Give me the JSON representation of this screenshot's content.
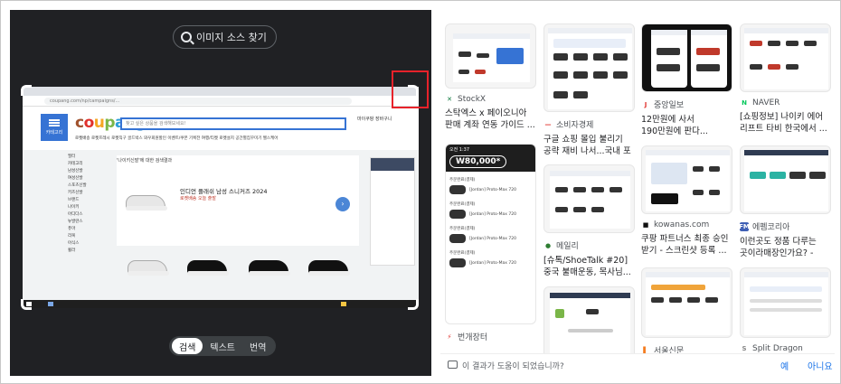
{
  "left_panel": {
    "find_source_label": "이미지 소스 찾기",
    "modes": [
      "검색",
      "텍스트",
      "번역"
    ],
    "screenshot": {
      "url": "coupang.com/np/campaigns/...",
      "logo": [
        "c",
        "o",
        "u",
        "p",
        "a",
        "n",
        "g"
      ],
      "menu_label": "카테고리",
      "search_placeholder": "찾고 싶은 상품을 검색해보세요!",
      "categories": "로켓배송  로켓프레시  로켓직구  골드박스  와우회원할인  이벤트/쿠폰  기획전  여행/티켓  로켓설치  공간별집꾸미기  헬스케어",
      "header_icons": "마이쿠팡   장바구니",
      "sidebar": [
        "필터",
        "카테고리",
        "남성신발",
        "여성신발",
        "스포츠신발",
        "키즈신발",
        "브랜드",
        "나이키",
        "아디다스",
        "뉴발란스",
        "퓨마",
        "리복",
        "아식스",
        "휠라"
      ],
      "banner_top": "'나이키신발'에 대한 검색결과",
      "banner_title": "인디언 플래쉬 남성 스니커즈 2024",
      "banner_sub": "로켓배송  오늘 출발"
    }
  },
  "results": [
    {
      "source": "StockX",
      "title": "스탁엑스 x 페이오니아 판매 계좌 연동 가이드 ...",
      "fav_color": "#0d7a3e",
      "fav_glyph": "✕"
    },
    {
      "source": "소비자경제",
      "title": "구글 쇼핑 몰입 불리기 공략 재비 나서...국내 포 ...",
      "fav_color": "#e0312c",
      "fav_glyph": "—"
    },
    {
      "source": "중앙일보",
      "title": "12만원에 사서 190만원에 판다...스니커즈 리셀앱 ...",
      "fav_color": "#e0312c",
      "fav_glyph": "J"
    },
    {
      "source": "NAVER",
      "title": "[쇼핑정보] 나이키 에어 리프트 타비 한국에서 ...",
      "fav_color": "#03c75a",
      "fav_glyph": "N"
    },
    {
      "source": "메일리",
      "title": "[슈톡/ShoeTalk #20] 중국 불매운동, 목사님...",
      "fav_color": "#2e7d32",
      "fav_glyph": "●"
    },
    {
      "source": "kowanas.com",
      "title": "쿠팡 파트너스 최종 승인 받기 - 스크린샷 등록 ...",
      "fav_color": "#111111",
      "fav_glyph": "■"
    },
    {
      "source": "에펨코리아",
      "title": "이런곳도 정품 다루는 곳이라매장인가요? - 패션 - ...",
      "fav_color": "#3f5fb5",
      "fav_glyph": "FM"
    },
    {
      "source": "번개장터",
      "title": "",
      "fav_color": "#e0312c",
      "fav_glyph": "⚡"
    },
    {
      "source": "서울신문",
      "title": "",
      "fav_color": "#f47c20",
      "fav_glyph": "▌"
    },
    {
      "source": "Split Dragon",
      "title": "",
      "fav_color": "#888888",
      "fav_glyph": "S"
    }
  ],
  "bunjang_card": {
    "time": "오전 1:37",
    "price": "W80,000*",
    "item_name": "[Jordan] Proto-Max 720",
    "rows": [
      "주문완료(결제)",
      "주문완료(결제)",
      "주문완료(결제)",
      "주문완료(결제)"
    ]
  },
  "feedback": {
    "question": "이 결과가 도움이 되었습니까?",
    "yes": "예",
    "no": "아니요"
  },
  "colors": {
    "dark_panel": "#202124",
    "selection_box": "#e8222a",
    "link_blue": "#1a73e8",
    "coupang_blue": "#3673d4"
  }
}
